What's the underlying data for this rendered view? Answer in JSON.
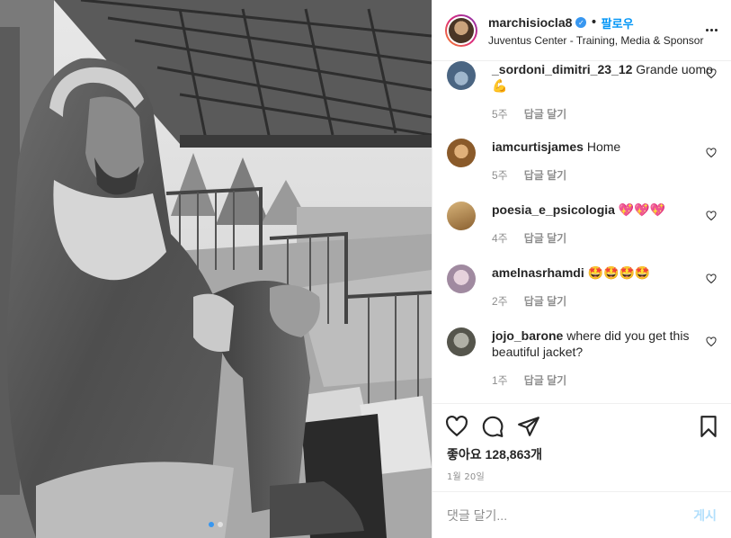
{
  "post": {
    "username": "marchisiocla8",
    "follow_separator": "•",
    "follow_label": "팔로우",
    "location": "Juventus Center - Training, Media & Sponsor",
    "likes_text": "좋아요 128,863개",
    "date_text": "1월 20일",
    "comment_placeholder": "댓글 달기...",
    "post_button": "게시",
    "carousel": {
      "count": 2,
      "active_index": 0
    }
  },
  "comments": [
    {
      "user": "_sordoni_dimitri_23_12",
      "text": "Grande uomo 💪",
      "age": "5주",
      "reply": "답글 달기",
      "avatar_color": "#6b8aa8"
    },
    {
      "user": "iamcurtisjames",
      "text": "Home",
      "age": "5주",
      "reply": "답글 달기",
      "avatar_color": "#c88a4a"
    },
    {
      "user": "poesia_e_psicologia",
      "text": "💖💖💖",
      "age": "4주",
      "reply": "답글 달기",
      "avatar_color": "#b48a52"
    },
    {
      "user": "amelnasrhamdi",
      "text": "🤩🤩🤩🤩",
      "age": "2주",
      "reply": "답글 달기",
      "avatar_color": "#c9b8c8"
    },
    {
      "user": "jojo_barone",
      "text": "where did you get this beautiful jacket?",
      "age": "1주",
      "reply": "답글 달기",
      "avatar_color": "#8a8a80"
    }
  ],
  "icons": {
    "verified": "verified-badge-icon",
    "more": "more-options-icon",
    "like": "heart-outline-icon",
    "comment": "comment-bubble-icon",
    "share": "paper-plane-icon",
    "save": "bookmark-icon"
  },
  "colors": {
    "link_blue": "#0095f6",
    "verified_blue": "#3897f0",
    "muted_text": "#8e8e8e",
    "border": "#efefef",
    "post_disabled": "#b2dffc"
  }
}
